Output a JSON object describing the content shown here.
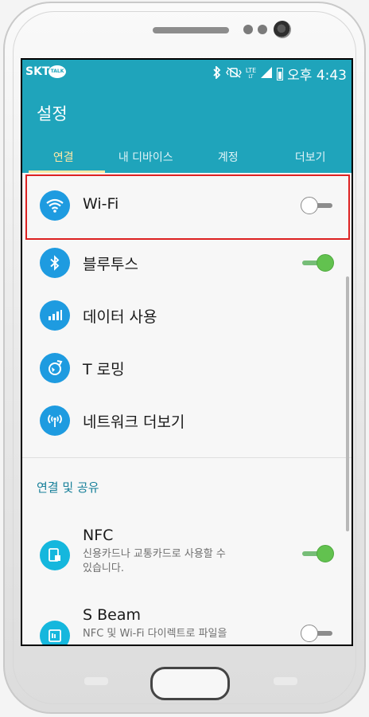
{
  "status_bar": {
    "carrier": "SKT",
    "talk_badge": "TALK",
    "network": "LTE",
    "network_sub": "LT",
    "time": "오후 4:43",
    "icons": [
      "bluetooth-icon",
      "vibrate-mute-icon",
      "signal-icon",
      "battery-icon"
    ]
  },
  "app_bar": {
    "title": "설정",
    "tabs": [
      {
        "label": "연결",
        "active": true
      },
      {
        "label": "내 디바이스",
        "active": false
      },
      {
        "label": "계정",
        "active": false
      },
      {
        "label": "더보기",
        "active": false
      }
    ]
  },
  "settings": [
    {
      "label": "Wi-Fi",
      "icon": "wifi-icon",
      "toggle": "off"
    },
    {
      "label": "블루투스",
      "icon": "bluetooth-icon",
      "toggle": "on"
    },
    {
      "label": "데이터 사용",
      "icon": "data-usage-icon"
    },
    {
      "label": "T 로밍",
      "icon": "roaming-icon"
    },
    {
      "label": "네트워크 더보기",
      "icon": "network-more-icon"
    }
  ],
  "section": {
    "title": "연결 및 공유",
    "items": [
      {
        "label": "NFC",
        "subtitle_line1": "신용카드나 교통카드로 사용할 수",
        "subtitle_line2": "있습니다.",
        "icon": "nfc-icon",
        "toggle": "on"
      },
      {
        "label": "S Beam",
        "subtitle_line1": "NFC 및 Wi-Fi 다이렉트로 파일을",
        "icon": "s-beam-icon",
        "toggle": "off"
      }
    ]
  },
  "colors": {
    "accent": "#1fa4bb",
    "tab_active": "#ffe9a6",
    "icon_blue": "#1e9be0",
    "toggle_on": "#62c24f",
    "highlight": "#d22222"
  }
}
